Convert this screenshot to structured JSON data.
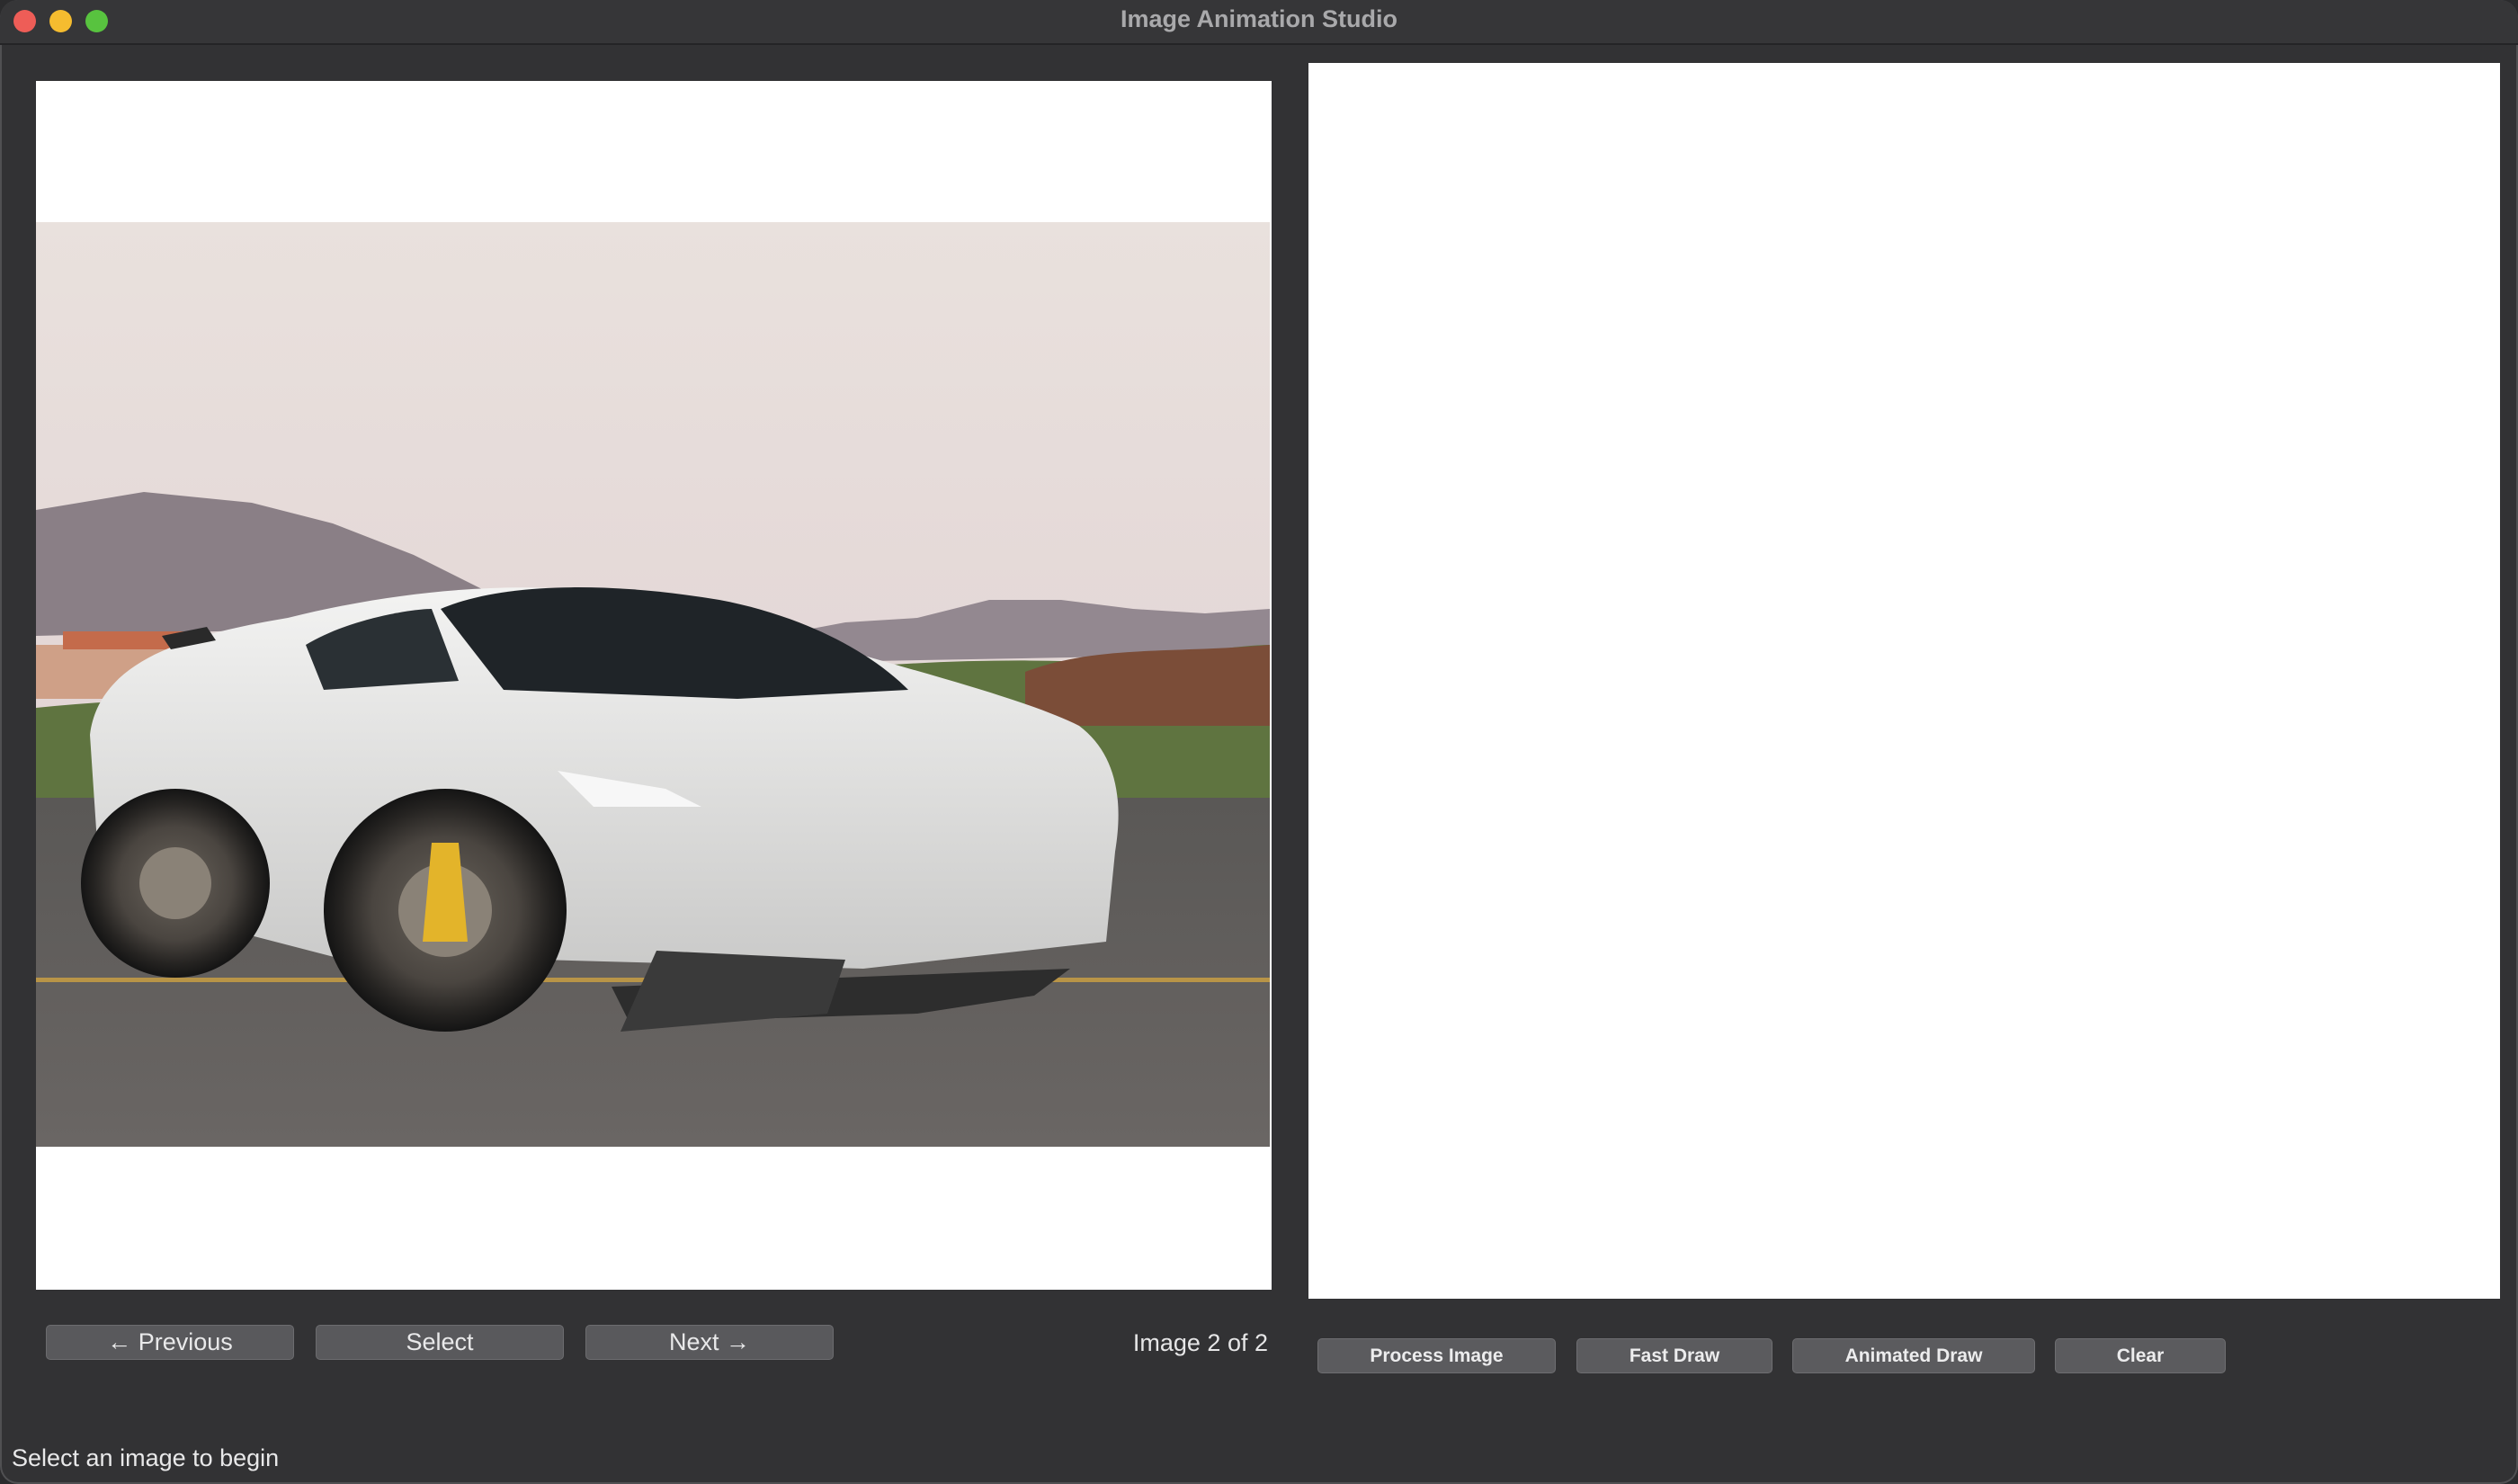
{
  "window": {
    "title": "Image Animation Studio"
  },
  "viewer": {
    "image_alt": "White sports car parked on a road with mountains in the background",
    "counter": "Image 2 of 2"
  },
  "nav": {
    "previous_label": "← Previous",
    "select_label": "Select",
    "next_label": "Next →"
  },
  "actions": {
    "process_label": "Process Image",
    "fast_draw_label": "Fast Draw",
    "animated_draw_label": "Animated Draw",
    "clear_label": "Clear"
  },
  "status": {
    "text": "Select an image to begin"
  },
  "colors": {
    "window_bg": "#323234",
    "button_bg": "#59595c",
    "canvas_bg": "#ffffff",
    "close": "#ee5d57",
    "minimize": "#f5bc2f",
    "maximize": "#58c33f"
  }
}
